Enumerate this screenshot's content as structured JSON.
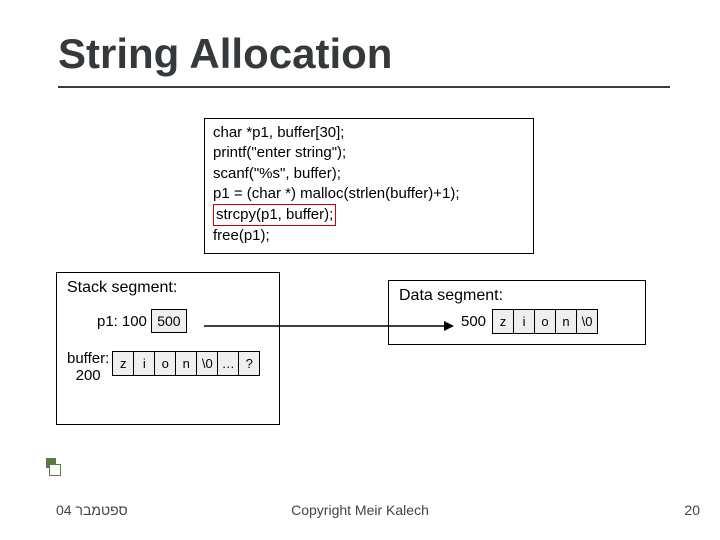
{
  "title": "String Allocation",
  "code": {
    "l1": "char *p1, buffer[30];",
    "l2": "printf(\"enter string\");",
    "l3": "scanf(\"%s\", buffer);",
    "l4": "p1 = (char *) malloc(strlen(buffer)+1);",
    "l5": "strcpy(p1, buffer);",
    "l6": "free(p1);"
  },
  "stack": {
    "title": "Stack segment:",
    "p1_label": "p1:",
    "p1_addr": "100",
    "p1_val": "500",
    "buffer_label_top": "buffer:",
    "buffer_label_bot": "200",
    "cells": [
      "z",
      "i",
      "o",
      "n",
      "\\0",
      "…",
      "?"
    ]
  },
  "data": {
    "title": "Data segment:",
    "addr": "500",
    "cells": [
      "z",
      "i",
      "o",
      "n",
      "\\0"
    ]
  },
  "footer": {
    "left": "ספטמבר 04",
    "center": "Copyright Meir Kalech",
    "right": "20"
  }
}
